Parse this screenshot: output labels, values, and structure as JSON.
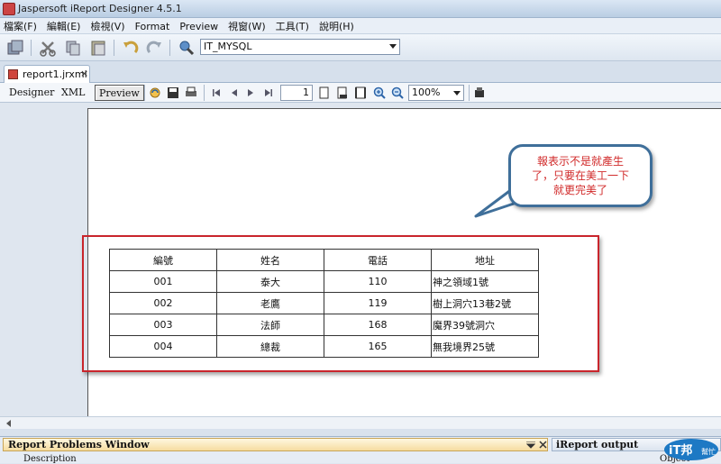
{
  "window": {
    "title": "Jaspersoft iReport Designer 4.5.1"
  },
  "menu": [
    "檔案(F)",
    "編輯(E)",
    "檢視(V)",
    "Format",
    "Preview",
    "視窗(W)",
    "工具(T)",
    "說明(H)"
  ],
  "toolbar": {
    "connection": "IT_MYSQL"
  },
  "document_tab": {
    "label": "report1.jrxml",
    "close": "×"
  },
  "view_tabs": {
    "designer": "Designer",
    "xml": "XML",
    "preview": "Preview"
  },
  "preview_toolbar": {
    "page": "1",
    "zoom": "100%"
  },
  "report_table": {
    "headers": [
      "編號",
      "姓名",
      "電話",
      "地址"
    ],
    "rows": [
      [
        "001",
        "泰大",
        "110",
        "神之領域1號"
      ],
      [
        "002",
        "老鷹",
        "119",
        "樹上洞穴13巷2號"
      ],
      [
        "003",
        "法師",
        "168",
        "魔界39號洞穴"
      ],
      [
        "004",
        "總裁",
        "165",
        "無我境界25號"
      ]
    ]
  },
  "annotation": {
    "line1": "報表示不是就產生",
    "line2": "了，只要在美工一下",
    "line3": "就更完美了"
  },
  "bottom_panel": {
    "problems_title": "Report Problems Window",
    "output_title": "iReport output",
    "col_description": "Description",
    "col_object": "Object"
  },
  "logo": {
    "text": "iT邦",
    "sub": "幫忙"
  },
  "colors": {
    "highlight": "#c9252c",
    "bubble_border": "#3f6f9a",
    "bubble_text": "#d12a2a"
  }
}
